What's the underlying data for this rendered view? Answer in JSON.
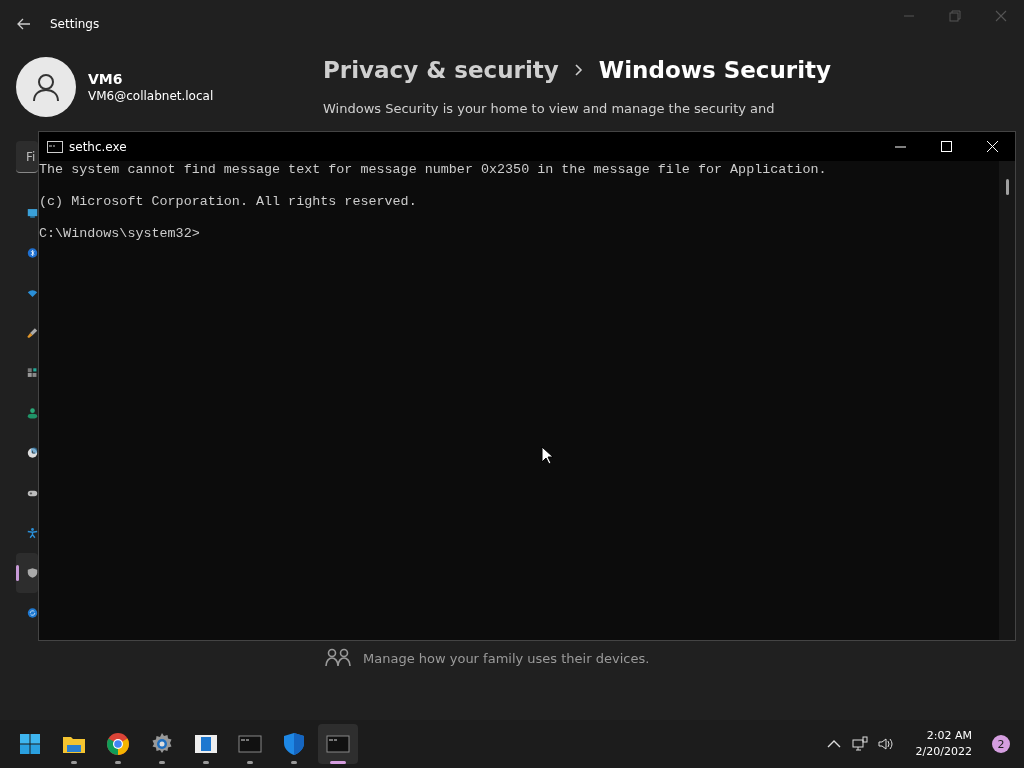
{
  "settings": {
    "title": "Settings",
    "user": {
      "name": "VM6",
      "email": "VM6@collabnet.local"
    },
    "search": {
      "placeholder": "Fi"
    },
    "nav_items": [
      {
        "kind": "system",
        "selected": false
      },
      {
        "kind": "bluetooth",
        "selected": false
      },
      {
        "kind": "network",
        "selected": false
      },
      {
        "kind": "personalization",
        "selected": false
      },
      {
        "kind": "apps",
        "selected": false
      },
      {
        "kind": "accounts",
        "selected": false
      },
      {
        "kind": "time",
        "selected": false
      },
      {
        "kind": "gaming",
        "selected": false
      },
      {
        "kind": "accessibility",
        "selected": false
      },
      {
        "kind": "privacy",
        "selected": true
      },
      {
        "kind": "update",
        "selected": false
      }
    ],
    "breadcrumb": {
      "parent": "Privacy & security",
      "current": "Windows Security"
    },
    "description": "Windows Security is your home to view and manage the security and",
    "family": {
      "text": "Manage how your family uses their devices."
    }
  },
  "console": {
    "title": "sethc.exe",
    "lines": [
      "The system cannot find message text for message number 0x2350 in the message file for Application.",
      "(c) Microsoft Corporation. All rights reserved.",
      "C:\\Windows\\system32>"
    ]
  },
  "taskbar": {
    "apps": [
      {
        "kind": "start",
        "running": false,
        "active": false
      },
      {
        "kind": "explorer",
        "running": true,
        "active": false
      },
      {
        "kind": "chrome",
        "running": true,
        "active": false
      },
      {
        "kind": "settings",
        "running": true,
        "active": false
      },
      {
        "kind": "notepad",
        "running": true,
        "active": false
      },
      {
        "kind": "console",
        "running": true,
        "active": false
      },
      {
        "kind": "security",
        "running": true,
        "active": false
      },
      {
        "kind": "console",
        "running": true,
        "active": true
      }
    ],
    "time": "2:02 AM",
    "date": "2/20/2022",
    "notifications": "2"
  }
}
